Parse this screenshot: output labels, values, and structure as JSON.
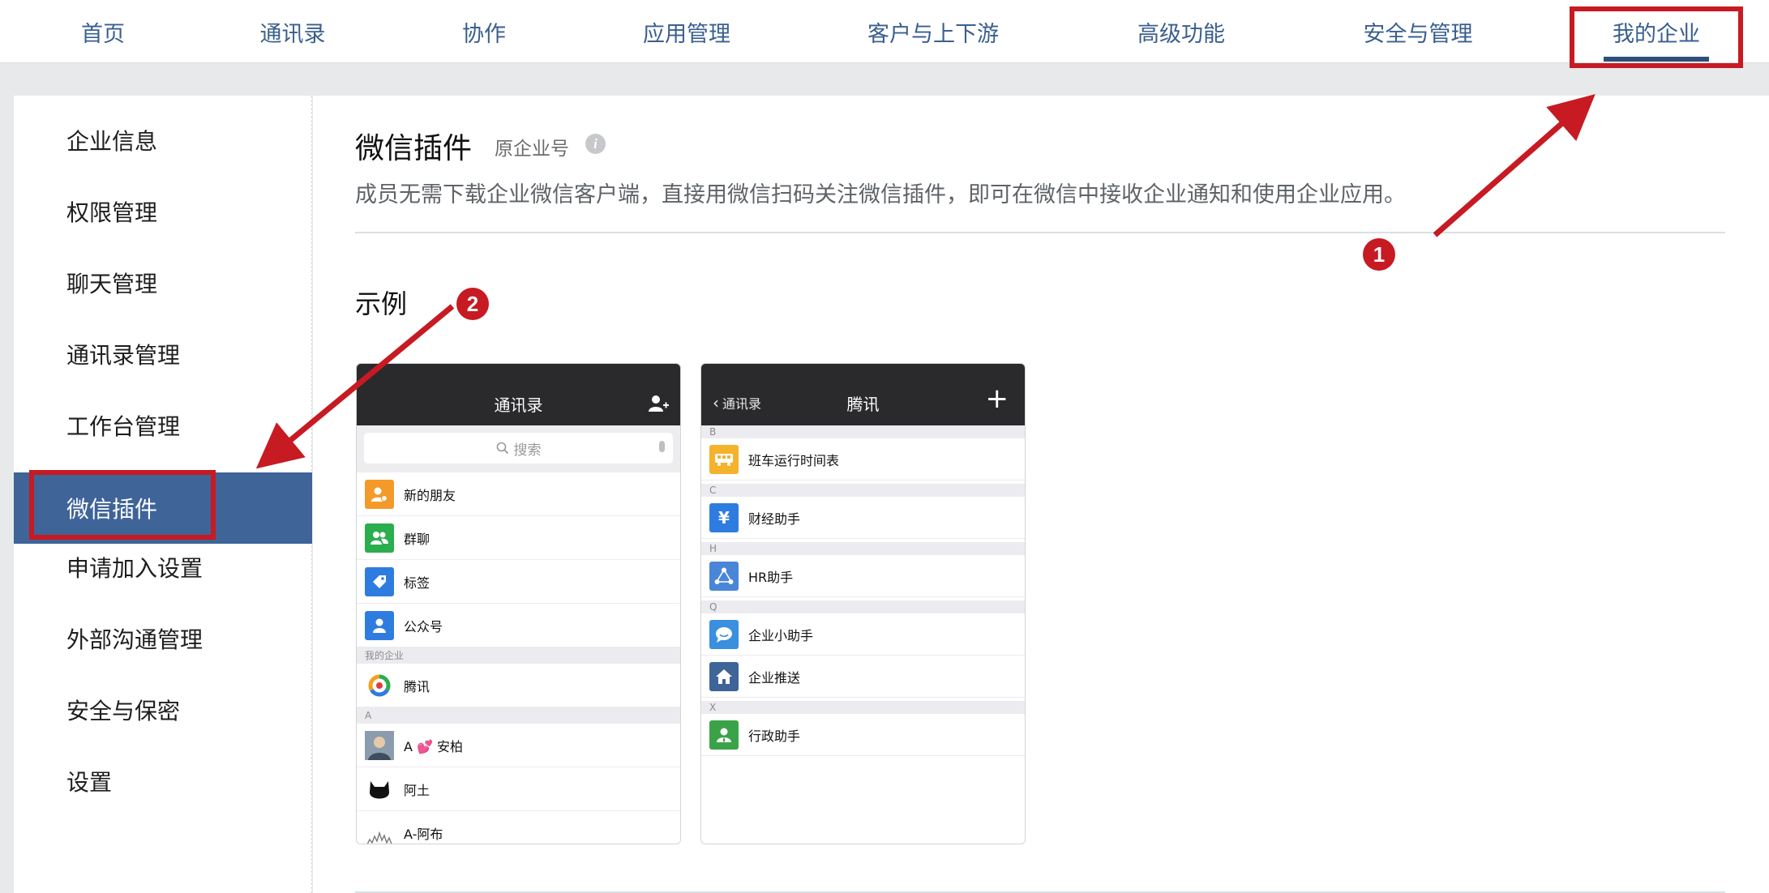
{
  "topnav": {
    "items": [
      "首页",
      "通讯录",
      "协作",
      "应用管理",
      "客户与上下游",
      "高级功能",
      "安全与管理",
      "我的企业"
    ],
    "active_index": 7
  },
  "sidebar": {
    "items": [
      "企业信息",
      "权限管理",
      "聊天管理",
      "通讯录管理",
      "工作台管理",
      "微信插件",
      "申请加入设置",
      "外部沟通管理",
      "安全与保密",
      "设置"
    ],
    "active_index": 5
  },
  "main": {
    "title": "微信插件",
    "subtitle": "原企业号",
    "info_icon": "i",
    "description": "成员无需下载企业微信客户端，直接用微信扫码关注微信插件，即可在微信中接收企业通知和使用企业应用。",
    "section_title": "示例"
  },
  "phone1": {
    "title": "通讯录",
    "search_placeholder": "搜索",
    "rows": [
      {
        "label": "新的朋友",
        "icon": "new-friend-icon",
        "color": "#f39a2b"
      },
      {
        "label": "群聊",
        "icon": "group-chat-icon",
        "color": "#2aae4e"
      },
      {
        "label": "标签",
        "icon": "tag-icon",
        "color": "#2f7ce0"
      },
      {
        "label": "公众号",
        "icon": "official-account-icon",
        "color": "#2f7ce0"
      }
    ],
    "section_my_company": "我的企业",
    "company": "腾讯",
    "section_a": "A",
    "contacts": [
      {
        "label": "A 💕 安柏"
      },
      {
        "label": "阿土"
      },
      {
        "label": "A-阿布"
      }
    ]
  },
  "phone2": {
    "back_label": "通讯录",
    "title": "腾讯",
    "plus": "+",
    "sections": {
      "b": "B",
      "c": "C",
      "h": "H",
      "q": "Q",
      "x": "X"
    },
    "rows": [
      {
        "label": "班车运行时间表",
        "icon": "bus-icon",
        "color": "#f5b22d"
      },
      {
        "label": "财经助手",
        "icon": "yen-icon",
        "glyph": "¥",
        "color": "#2f7ce0"
      },
      {
        "label": "HR助手",
        "icon": "hr-icon",
        "color": "#4a86d8"
      },
      {
        "label": "企业小助手",
        "icon": "chat-bubble-icon",
        "color": "#3a8fde"
      },
      {
        "label": "企业推送",
        "icon": "home-icon",
        "color": "#3e6498"
      },
      {
        "label": "行政助手",
        "icon": "admin-icon",
        "color": "#3aa348"
      }
    ]
  },
  "annotations": {
    "badge1": "1",
    "badge2": "2",
    "color": "#c71a22"
  }
}
